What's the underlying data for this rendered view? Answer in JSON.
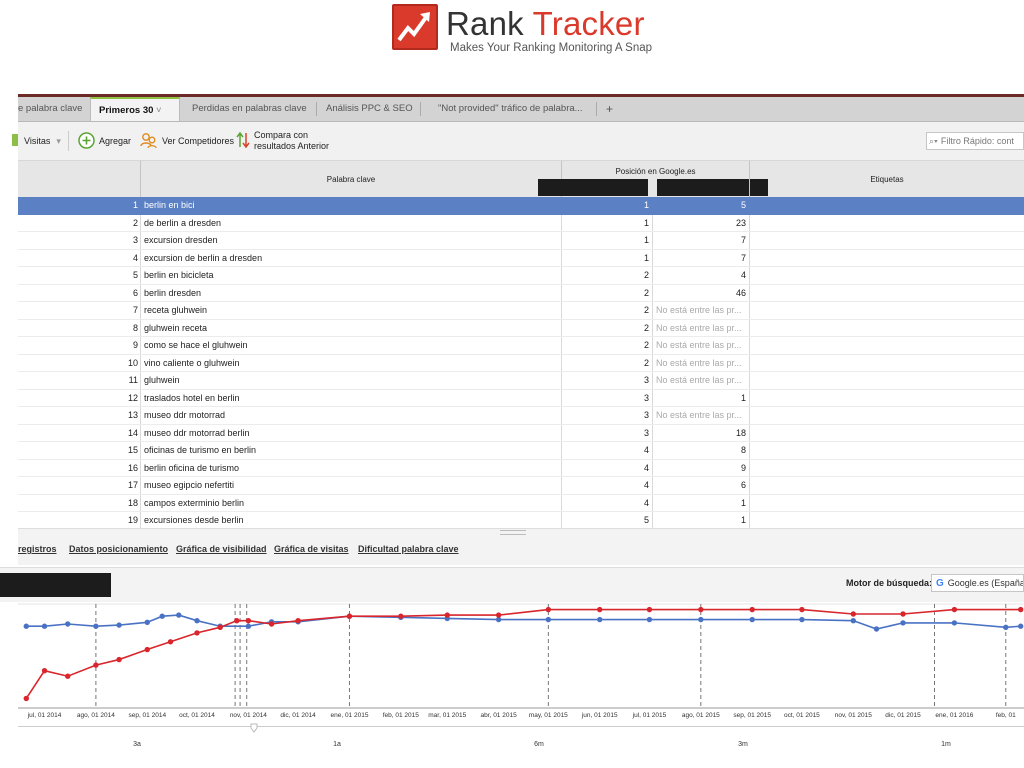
{
  "logo": {
    "name_part1": "Rank",
    "name_part2": "Tracker",
    "tagline": "Makes Your Ranking Monitoring A Snap"
  },
  "tabs": [
    {
      "label": "e palabra clave",
      "active": false
    },
    {
      "label": "Primeros 30",
      "active": true
    },
    {
      "label": "Perdidas en palabras clave",
      "active": false
    },
    {
      "label": "Análisis PPC & SEO",
      "active": false
    },
    {
      "label": "\"Not provided\" tráfico de palabra...",
      "active": false
    }
  ],
  "tab_add_label": "+",
  "tab_dropdown_label": "˅",
  "toolbar": {
    "visitas_label": "Visitas",
    "agregar_label": "Agregar",
    "competidores_label": "Ver Competidores",
    "compara_label_1": "Compara con",
    "compara_label_2": "resultados Anterior",
    "filter_placeholder": "Filtro Rápido: cont"
  },
  "grid": {
    "col_keyword": "Palabra clave",
    "col_position": "Posición en Google.es",
    "col_tags": "Etiquetas",
    "rows": [
      {
        "n": "1",
        "kw": "berlin en bici",
        "p1": "1",
        "p2": "5"
      },
      {
        "n": "2",
        "kw": "de berlin a dresden",
        "p1": "1",
        "p2": "23"
      },
      {
        "n": "3",
        "kw": "excursion dresden",
        "p1": "1",
        "p2": "7"
      },
      {
        "n": "4",
        "kw": "excursion de berlin a dresden",
        "p1": "1",
        "p2": "7"
      },
      {
        "n": "5",
        "kw": "berlin en bicicleta",
        "p1": "2",
        "p2": "4"
      },
      {
        "n": "6",
        "kw": "berlin dresden",
        "p1": "2",
        "p2": "46"
      },
      {
        "n": "7",
        "kw": "receta gluhwein",
        "p1": "2",
        "p2": "No está entre las pr..."
      },
      {
        "n": "8",
        "kw": "gluhwein receta",
        "p1": "2",
        "p2": "No está entre las pr..."
      },
      {
        "n": "9",
        "kw": "como se hace el gluhwein",
        "p1": "2",
        "p2": "No está entre las pr..."
      },
      {
        "n": "10",
        "kw": "vino caliente o gluhwein",
        "p1": "2",
        "p2": "No está entre las pr..."
      },
      {
        "n": "11",
        "kw": "gluhwein",
        "p1": "3",
        "p2": "No está entre las pr..."
      },
      {
        "n": "12",
        "kw": "traslados hotel en berlin",
        "p1": "3",
        "p2": "1"
      },
      {
        "n": "13",
        "kw": "museo ddr motorrad",
        "p1": "3",
        "p2": "No está entre las pr..."
      },
      {
        "n": "14",
        "kw": "museo ddr motorrad berlin",
        "p1": "3",
        "p2": "18"
      },
      {
        "n": "15",
        "kw": "oficinas de turismo en berlin",
        "p1": "4",
        "p2": "8"
      },
      {
        "n": "16",
        "kw": "berlin oficina de turismo",
        "p1": "4",
        "p2": "9"
      },
      {
        "n": "17",
        "kw": "museo egipcio nefertiti",
        "p1": "4",
        "p2": "6"
      },
      {
        "n": "18",
        "kw": "campos exterminio berlin",
        "p1": "4",
        "p2": "1"
      },
      {
        "n": "19",
        "kw": "excursiones desde berlin",
        "p1": "5",
        "p2": "1"
      }
    ]
  },
  "bottom_tabs": [
    "registros",
    "Datos posicionamiento",
    "Gráfica de visibilidad",
    "Gráfica de visitas",
    "Dificultad palabra clave"
  ],
  "motor": {
    "label": "Motor de búsqueda:",
    "value": "Google.es (España",
    "icon_letter": "G"
  },
  "chart_data": {
    "type": "line",
    "x_ticks": [
      "jul, 01 2014",
      "ago, 01 2014",
      "sep, 01 2014",
      "oct, 01 2014",
      "nov, 01 2014",
      "dic, 01 2014",
      "ene, 01 2015",
      "feb, 01 2015",
      "mar, 01 2015",
      "abr, 01 2015",
      "may, 01 2015",
      "jun, 01 2015",
      "jul, 01 2015",
      "ago, 01 2015",
      "sep, 01 2015",
      "oct, 01 2015",
      "nov, 01 2015",
      "dic, 01 2015",
      "ene, 01 2016",
      "feb, 01"
    ],
    "range_labels": [
      "3a",
      "1a",
      "6m",
      "3m",
      "1m"
    ],
    "series": [
      {
        "color": "#4a72c4",
        "x": [
          "2014-06-20",
          "2014-07-01",
          "2014-07-15",
          "2014-08-01",
          "2014-08-15",
          "2014-09-01",
          "2014-09-10",
          "2014-09-20",
          "2014-10-01",
          "2014-10-15",
          "2014-11-01",
          "2014-11-15",
          "2014-12-01",
          "2015-01-01",
          "2015-02-01",
          "2015-03-01",
          "2015-04-01",
          "2015-05-01",
          "2015-06-01",
          "2015-07-01",
          "2015-08-01",
          "2015-09-01",
          "2015-10-01",
          "2015-11-01",
          "2015-11-15",
          "2015-12-01",
          "2016-01-01",
          "2016-02-01",
          "2016-02-10"
        ],
        "y": [
          5,
          5,
          4.6,
          5,
          4.8,
          4.3,
          3.2,
          3,
          4,
          5,
          5,
          4.2,
          4.2,
          3.2,
          3.4,
          3.6,
          3.8,
          3.8,
          3.8,
          3.8,
          3.8,
          3.8,
          3.8,
          4,
          5.5,
          4.4,
          4.4,
          5.2,
          5
        ]
      },
      {
        "color": "#d8262c",
        "x": [
          "2014-06-20",
          "2014-07-01",
          "2014-07-15",
          "2014-08-01",
          "2014-08-15",
          "2014-09-01",
          "2014-09-15",
          "2014-10-01",
          "2014-10-15",
          "2014-10-25",
          "2014-11-01",
          "2014-11-15",
          "2014-12-01",
          "2015-01-01",
          "2015-02-01",
          "2015-03-01",
          "2015-04-01",
          "2015-05-01",
          "2015-06-01",
          "2015-07-01",
          "2015-08-01",
          "2015-09-01",
          "2015-10-01",
          "2015-11-01",
          "2015-12-01",
          "2016-01-01",
          "2016-02-10"
        ],
        "y": [
          18,
          13,
          14,
          12,
          11,
          9.2,
          7.8,
          6.2,
          5.2,
          4,
          4,
          4.6,
          4,
          3.2,
          3.2,
          3,
          3,
          2,
          2,
          2,
          2,
          2,
          2,
          2.8,
          2.8,
          2,
          2
        ]
      }
    ]
  }
}
